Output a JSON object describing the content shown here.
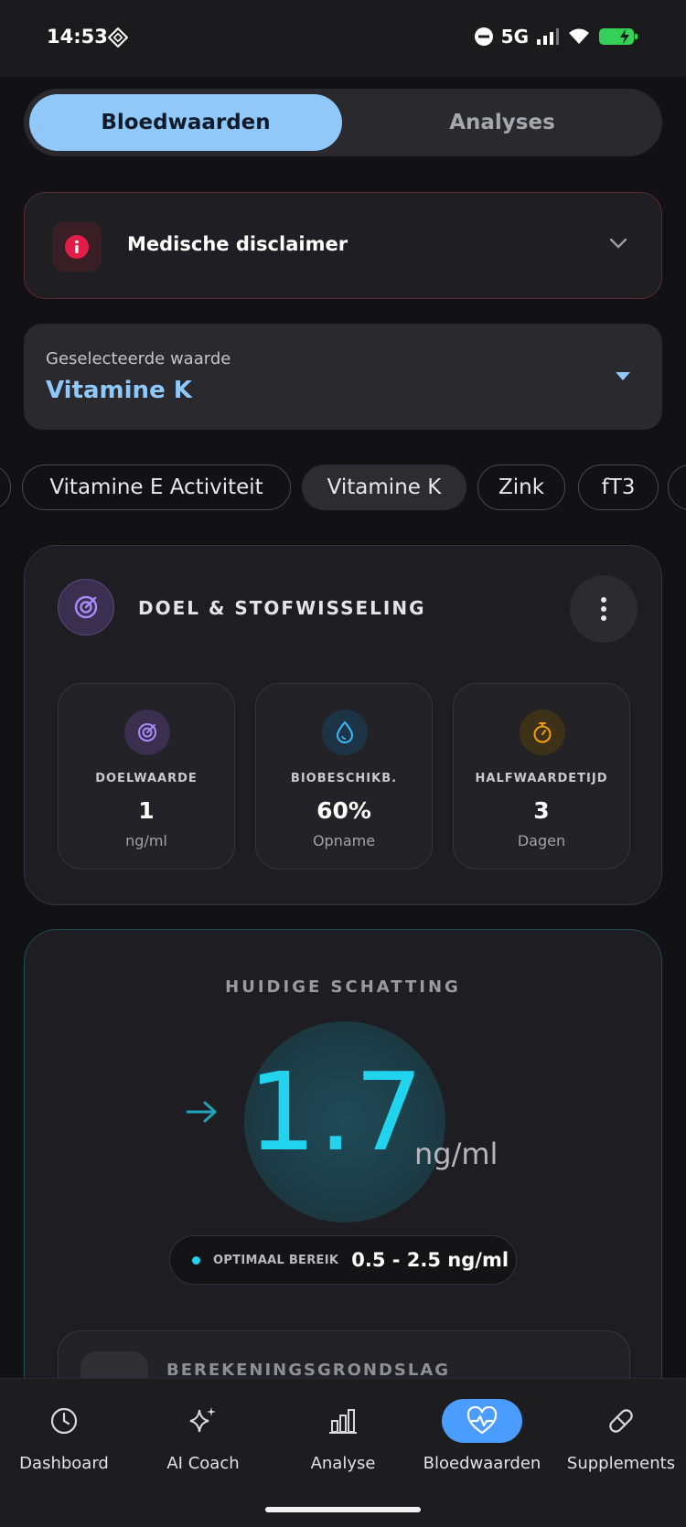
{
  "status_bar": {
    "time": "14:53",
    "network": "5G",
    "icons": [
      "nfc-icon",
      "dnd-icon",
      "signal-icon",
      "wifi-icon",
      "battery-charging-icon"
    ]
  },
  "tabs": {
    "active": "Bloedwaarden",
    "inactive": "Analyses"
  },
  "disclaimer": {
    "title": "Medische disclaimer",
    "icon": "info-icon",
    "accent": "#e11d48"
  },
  "selector": {
    "label": "Geselecteerde waarde",
    "value": "Vitamine K"
  },
  "chips": [
    "",
    "Vitamine E Activiteit",
    "Vitamine K",
    "Zink",
    "fT3",
    ""
  ],
  "metabolism_card": {
    "title": "DOEL & STOFWISSELING",
    "stats": [
      {
        "label": "DOELWAARDE",
        "value": "1",
        "unit": "ng/ml",
        "icon": "target-icon",
        "color": "#a78bfa"
      },
      {
        "label": "BIOBESCHIKB.",
        "value": "60%",
        "unit": "Opname",
        "icon": "droplet-icon",
        "color": "#38bdf8"
      },
      {
        "label": "HALFWAARDETIJD",
        "value": "3",
        "unit": "Dagen",
        "icon": "stopwatch-icon",
        "color": "#f59e0b"
      }
    ]
  },
  "estimate_card": {
    "title": "HUIDIGE SCHATTING",
    "value": "1.7",
    "unit": "ng/ml",
    "trend_icon": "arrow-right-icon",
    "range_label": "OPTIMAAL BEREIK",
    "range_value": "0.5 - 2.5 ng/ml",
    "accent": "#22d3ee",
    "basis_title": "BEREKENINGSGRONDSLAG"
  },
  "nav": [
    {
      "label": "Dashboard",
      "icon": "clock-icon",
      "active": false
    },
    {
      "label": "AI Coach",
      "icon": "sparkles-icon",
      "active": false
    },
    {
      "label": "Analyse",
      "icon": "bar-chart-icon",
      "active": false
    },
    {
      "label": "Bloedwaarden",
      "icon": "heart-pulse-icon",
      "active": true
    },
    {
      "label": "Supplements",
      "icon": "pill-icon",
      "active": false
    }
  ]
}
